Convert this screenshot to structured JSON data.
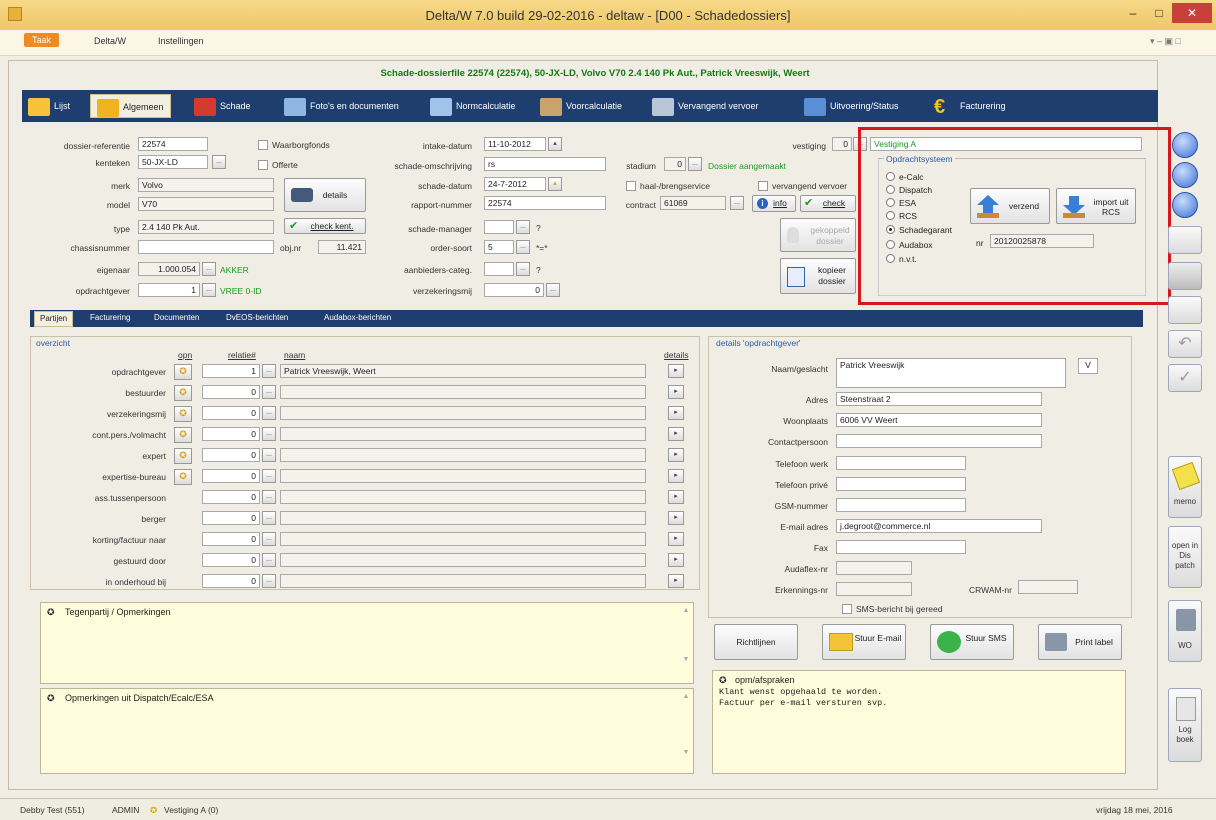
{
  "window": {
    "title": "Delta/W 7.0 build 29-02-2016 - deltaw - [D00 - Schadedossiers]"
  },
  "menu": {
    "items": [
      "Taak",
      "Delta/W",
      "Instellingen"
    ]
  },
  "heading": "Schade-dossierfile 22574 (22574), 50-JX-LD, Volvo V70 2.4 140 Pk Aut., Patrick Vreeswijk, Weert",
  "tabs": [
    "Lijst",
    "Algemeen",
    "Schade",
    "Foto's en documenten",
    "Normcalculatie",
    "Voorcalculatie",
    "Vervangend vervoer",
    "Uitvoering/Status",
    "Facturering"
  ],
  "left": {
    "labels": [
      "dossier-referentie",
      "kenteken",
      "merk",
      "model",
      "type",
      "chassisnummer",
      "eigenaar",
      "opdrachtgever"
    ],
    "dossier": "22574",
    "kenteken": "50-JX-LD",
    "merk": "Volvo",
    "model": "V70",
    "type": "2.4 140 Pk Aut.",
    "chassis": "",
    "eigenaar_num": "1.000.054",
    "eigenaar_name": "AKKER",
    "opdrachtgever_num": "1",
    "opdrachtgever_name": "VREE 0-ID"
  },
  "mid": {
    "waarborgfonds": "Waarborgfonds",
    "offerte": "Offerte",
    "details": "details",
    "check_kent": "check kent.",
    "obj_label": "obj.nr",
    "obj_value": "11.421"
  },
  "fields": {
    "labels": [
      "intake-datum",
      "schade-omschrijving",
      "schade-datum",
      "rapport-nummer",
      "schade-manager",
      "order-soort",
      "aanbieders-categ.",
      "verzekeringsmij"
    ],
    "intake": "11-10-2012",
    "omschrijving": "rs",
    "schade_datum": "24-7-2012",
    "rapport": "22574",
    "manager": "",
    "manager_q": "?",
    "order": "5",
    "order_q": "*=*",
    "aanbieders": "",
    "aanbieders_q": "?",
    "verzekering": "0"
  },
  "status": {
    "stadium_label": "stadium",
    "stadium_value": "0",
    "stadium_text": "Dossier aangemaakt",
    "haal": "haal-/brengservice",
    "vervangend": "vervangend vervoer",
    "contract_label": "contract",
    "contract_value": "61069",
    "info": "info",
    "check": "check",
    "gekoppeld": "gekoppeld dossier",
    "kopieer": "kopieer dossier"
  },
  "vestiging": {
    "label": "vestiging",
    "num": "0",
    "value": "Vestiging A"
  },
  "opdrachtsysteem": {
    "title": "Opdrachtsysteem",
    "options": [
      "e-Calc",
      "Dispatch",
      "ESA",
      "RCS",
      "Schadegarant",
      "Audabox",
      "n.v.t."
    ],
    "selected_index": 4,
    "nr_label": "nr",
    "nr_value": "20120025878",
    "verzend": "verzend",
    "import": "import uit RCS"
  },
  "subtabs": [
    "Partijen",
    "Facturering",
    "Documenten",
    "DvEOS-berichten",
    "Audabox-berichten"
  ],
  "overzicht": {
    "title": "overzicht",
    "col_opn": "opn",
    "col_relatie": "relatie#",
    "col_naam": "naam",
    "col_details": "details",
    "rows": [
      {
        "label": "opdrachtgever",
        "star": true,
        "rel": "1",
        "naam": "Patrick Vreeswijk, Weert"
      },
      {
        "label": "bestuurder",
        "star": true,
        "rel": "0",
        "naam": ""
      },
      {
        "label": "verzekeringsmij",
        "star": true,
        "rel": "0",
        "naam": ""
      },
      {
        "label": "cont.pers./volmacht",
        "star": true,
        "rel": "0",
        "naam": ""
      },
      {
        "label": "expert",
        "star": true,
        "rel": "0",
        "naam": ""
      },
      {
        "label": "expertise-bureau",
        "star": true,
        "rel": "0",
        "naam": ""
      },
      {
        "label": "ass.tussenpersoon",
        "star": false,
        "rel": "0",
        "naam": ""
      },
      {
        "label": "berger",
        "star": false,
        "rel": "0",
        "naam": ""
      },
      {
        "label": "korting/factuur naar",
        "star": false,
        "rel": "0",
        "naam": ""
      },
      {
        "label": "gestuurd door",
        "star": false,
        "rel": "0",
        "naam": ""
      },
      {
        "label": "in onderhoud bij",
        "star": false,
        "rel": "0",
        "naam": ""
      }
    ]
  },
  "notes": {
    "tegenpartij": "Tegenpartij / Opmerkingen",
    "opmerkingen": "Opmerkingen uit Dispatch/Ecalc/ESA",
    "afspraken_title": "opm/afspraken",
    "afspraken_lines": [
      "Klant wenst opgehaald te worden.",
      "Factuur per e-mail versturen svp."
    ]
  },
  "details": {
    "title": "details 'opdrachtgever'",
    "labels": [
      "Naam/geslacht",
      "Adres",
      "Woonplaats",
      "Contactpersoon",
      "Telefoon werk",
      "Telefoon privé",
      "GSM-nummer",
      "E-mail adres",
      "Fax",
      "Audaflex-nr",
      "Erkennings-nr"
    ],
    "naam": "Patrick Vreeswijk",
    "geslacht": "V",
    "adres": "Steenstraat 2",
    "woonplaats": "6006 VV  Weert",
    "email": "j.degroot@commerce.nl",
    "crwam_label": "CRWAM-nr",
    "sms_check": "SMS-bericht bij gereed"
  },
  "actions": {
    "richtlijnen": "Richtlijnen",
    "stuur_email": "Stuur E-mail",
    "stuur_sms": "Stuur SMS",
    "print_label": "Print label"
  },
  "rightbar": {
    "memo": "memo",
    "open_dispatch": "open in Dis patch",
    "wo": "WO",
    "logboek": "Log boek"
  },
  "statusbar": {
    "left": "Debby Test (551)",
    "user": "ADMIN",
    "vestiging": "Vestiging A (0)",
    "right": "vrijdag 18 mei, 2016"
  }
}
